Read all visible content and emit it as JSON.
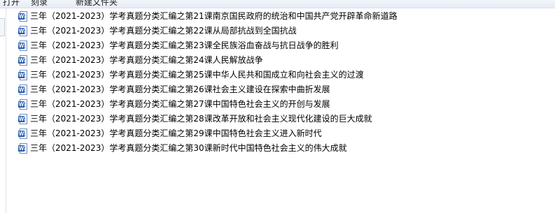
{
  "toolbar": {
    "items": [
      {
        "label": "打开"
      },
      {
        "label": "刻录"
      },
      {
        "label": "新建文件夹"
      }
    ]
  },
  "file_list": {
    "items": [
      {
        "name": "三年（2021-2023）学考真题分类汇编之第21课南京国民政府的统治和中国共产党开辟革命新道路",
        "icon": "word-document-icon"
      },
      {
        "name": "三年（2021-2023）学考真题分类汇编之第22课从局部抗战到全国抗战",
        "icon": "word-document-icon"
      },
      {
        "name": "三年（2021-2023）学考真题分类汇编之第23课全民族浴血奋战与抗日战争的胜利",
        "icon": "word-document-icon"
      },
      {
        "name": "三年（2021-2023）学考真题分类汇编之第24课人民解放战争",
        "icon": "word-document-icon"
      },
      {
        "name": "三年（2021-2023）学考真题分类汇编之第25课中华人民共和国成立和向社会主义的过渡",
        "icon": "word-document-icon"
      },
      {
        "name": "三年（2021-2023）学考真题分类汇编之第26课社会主义建设在探索中曲折发展",
        "icon": "word-document-icon"
      },
      {
        "name": "三年（2021-2023）学考真题分类汇编之第27课中国特色社会主义的开创与发展",
        "icon": "word-document-icon"
      },
      {
        "name": "三年（2021-2023）学考真题分类汇编之第28课改革开放和社会主义现代化建设的巨大成就",
        "icon": "word-document-icon"
      },
      {
        "name": "三年（2021-2023）学考真题分类汇编之第29课中国特色社会主义进入新时代",
        "icon": "word-document-icon"
      },
      {
        "name": "三年（2021-2023）学考真题分类汇编之第30课新时代中国特色社会主义的伟大成就",
        "icon": "word-document-icon"
      }
    ]
  },
  "colors": {
    "word_badge": "#2b5fae",
    "toolbar_bg": "#e6ecf5",
    "text": "#000000"
  }
}
